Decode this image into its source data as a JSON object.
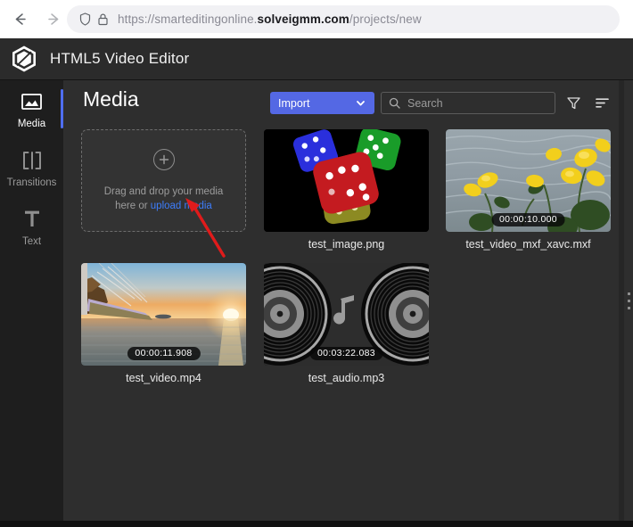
{
  "browser": {
    "back_label": "Back",
    "forward_label": "Forward",
    "shield_icon": "shield-icon",
    "lock_icon": "lock-icon",
    "url_prefix": "https://smarteditingonline.",
    "url_domain": "solveigmm.com",
    "url_path": "/projects/new"
  },
  "app": {
    "logo_icon": "solveigmm-hexagon-logo",
    "title": "HTML5 Video Editor"
  },
  "sidebar": {
    "items": [
      {
        "label": "Media",
        "icon": "image-icon",
        "active": true
      },
      {
        "label": "Transitions",
        "icon": "transition-icon",
        "active": false
      },
      {
        "label": "Text",
        "icon": "text-icon",
        "active": false
      }
    ]
  },
  "toolbar": {
    "title": "Media",
    "import_label": "Import",
    "import_chevron_icon": "chevron-down-icon",
    "import_color": "#5468e4",
    "search_placeholder": "Search",
    "search_value": "",
    "search_icon": "search-icon",
    "filter_icon": "filter-funnel-icon",
    "sort_icon": "sort-icon"
  },
  "dropzone": {
    "plus_icon": "plus-circle-icon",
    "text_line1": "Drag and drop your media",
    "text_line2_prefix": "here or ",
    "link_label": "upload media",
    "link_color": "#3d7dfb"
  },
  "media": [
    {
      "name": "test_image.png",
      "kind": "image",
      "duration": "",
      "thumb": "dice-on-black"
    },
    {
      "name": "test_video_mxf_xavc.mxf",
      "kind": "video",
      "duration": "00:00:10.000",
      "thumb": "yellow-flowers-water"
    },
    {
      "name": "test_video.mp4",
      "kind": "video",
      "duration": "00:00:11.908",
      "thumb": "sailing-ship-sunset-sea"
    },
    {
      "name": "test_audio.mp3",
      "kind": "audio",
      "duration": "00:03:22.083",
      "thumb": "vinyl-records-music-note"
    }
  ],
  "annotation": {
    "arrow_color": "#e01b1b",
    "arrow_target": "upload media"
  },
  "resize_handle": {
    "icon": "drag-dots-icon"
  }
}
